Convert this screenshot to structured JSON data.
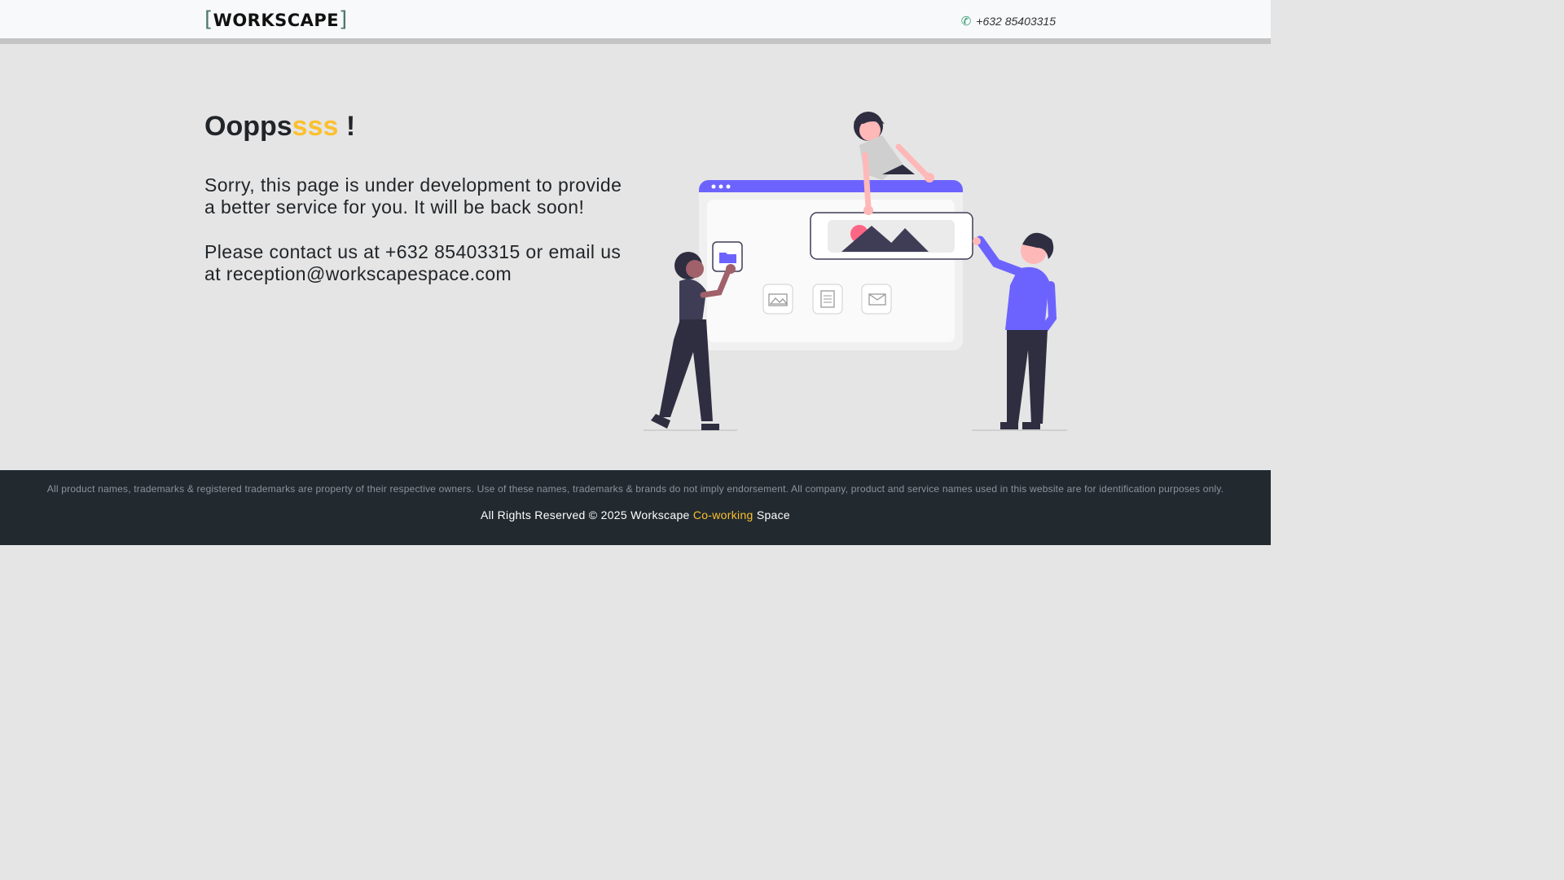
{
  "header": {
    "logo": {
      "bracket_open": "[",
      "name": "WORKSCAPE",
      "bracket_close": "]"
    },
    "phone": "+632 85403315",
    "phone_icon": "phone-icon"
  },
  "main": {
    "title_main": "Oopps",
    "title_accent": "sss",
    "title_end": " !",
    "message_1": "Sorry, this page is under development to provide a better service for you. It will be back soon!",
    "message_2": "Please contact us at +632 85403315 or email us at reception@workscapespace.com",
    "illustration": "under-construction-illustration"
  },
  "footer": {
    "disclaimer": "All product names, trademarks & registered trademarks are property of their respective owners. Use of these names, trademarks & brands do not imply endorsement. All company, product and service names used in this website are for identification purposes only.",
    "rights_prefix": "All Rights Reserved © 2025 Workscape ",
    "rights_accent": "Co-working",
    "rights_suffix": " Space"
  },
  "colors": {
    "accent": "#fbc02d",
    "brand_purple": "#6c63ff",
    "footer_bg": "#222a30",
    "page_bg": "#e5e5e5"
  }
}
